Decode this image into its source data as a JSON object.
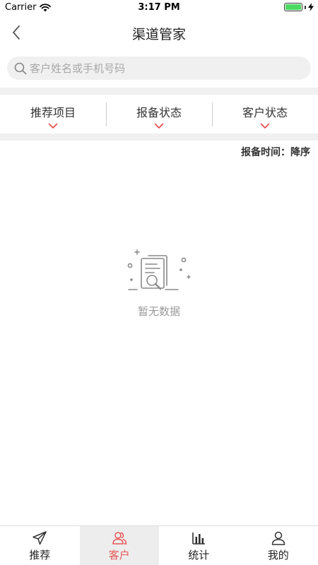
{
  "status_bar": {
    "carrier": "Carrier",
    "time": "3:17 PM",
    "battery_level": 1.0
  },
  "nav": {
    "title": "渠道管家",
    "back_icon": "chevron-left-icon"
  },
  "search": {
    "placeholder": "客户姓名或手机号码",
    "value": ""
  },
  "filters": [
    {
      "label": "推荐项目",
      "icon": "chevron-down-icon"
    },
    {
      "label": "报备状态",
      "icon": "chevron-down-icon"
    },
    {
      "label": "客户状态",
      "icon": "chevron-down-icon"
    }
  ],
  "sort": {
    "text": "报备时间：降序"
  },
  "empty": {
    "icon": "empty-document-search-icon",
    "text": "暂无数据"
  },
  "tabs": [
    {
      "label": "推荐",
      "icon": "paper-plane-icon",
      "active": false
    },
    {
      "label": "客户",
      "icon": "users-icon",
      "active": true
    },
    {
      "label": "统计",
      "icon": "bar-chart-icon",
      "active": false
    },
    {
      "label": "我的",
      "icon": "user-icon",
      "active": false
    }
  ],
  "colors": {
    "accent": "#e85656",
    "chevron": "#e84a4a",
    "muted_text": "#999999",
    "search_bg": "#f0f0f0",
    "active_tab_bg": "#ededed"
  }
}
